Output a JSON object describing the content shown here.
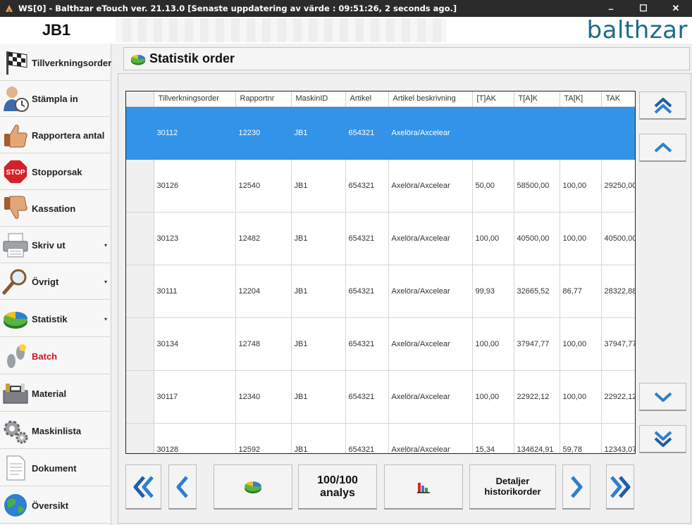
{
  "window": {
    "title": "WS[0] - Balthzar eTouch ver. 21.13.0  [Senaste uppdatering av värde : 09:51:26, 2 seconds ago.]",
    "minimize": "–",
    "maximize": "☐",
    "close": "✕"
  },
  "header": {
    "machine": "JB1",
    "brand": "balthzar"
  },
  "sidebar": {
    "items": [
      {
        "label": "Tillverkningsorder",
        "icon": "checkered-flag-icon",
        "arrow": ""
      },
      {
        "label": "Stämpla in",
        "icon": "user-clock-icon",
        "arrow": ""
      },
      {
        "label": "Rapportera antal",
        "icon": "thumbs-up-icon",
        "arrow": ""
      },
      {
        "label": "Stopporsak",
        "icon": "stop-sign-icon",
        "arrow": ""
      },
      {
        "label": "Kassation",
        "icon": "thumbs-down-icon",
        "arrow": ""
      },
      {
        "label": "Skriv ut",
        "icon": "printer-icon",
        "arrow": "▾"
      },
      {
        "label": "Övrigt",
        "icon": "magnifier-icon",
        "arrow": "▾"
      },
      {
        "label": "Statistik",
        "icon": "pie-chart-icon",
        "arrow": "▾"
      },
      {
        "label": "Batch",
        "icon": "footprints-icon",
        "arrow": ""
      },
      {
        "label": "Material",
        "icon": "toolbox-icon",
        "arrow": ""
      },
      {
        "label": "Maskinlista",
        "icon": "gears-icon",
        "arrow": ""
      },
      {
        "label": "Dokument",
        "icon": "document-icon",
        "arrow": ""
      },
      {
        "label": "Översikt",
        "icon": "globe-icon",
        "arrow": ""
      }
    ]
  },
  "page": {
    "title": "Statistik order"
  },
  "grid": {
    "columns": [
      "Tillverkningsorder",
      "Rapportnr",
      "MaskinID",
      "Artikel",
      "Artikel beskrivning",
      "[T]AK",
      "T[A]K",
      "TA[K]",
      "TAK"
    ],
    "rows": [
      [
        "30112",
        "12230",
        "JB1",
        "654321",
        "Axelöra/Axcelear",
        "",
        "",
        "",
        ""
      ],
      [
        "30126",
        "12540",
        "JB1",
        "654321",
        "Axelöra/Axcelear",
        "50,00",
        "58500,00",
        "100,00",
        "29250,00"
      ],
      [
        "30123",
        "12482",
        "JB1",
        "654321",
        "Axelöra/Axcelear",
        "100,00",
        "40500,00",
        "100,00",
        "40500,00"
      ],
      [
        "30111",
        "12204",
        "JB1",
        "654321",
        "Axelöra/Axcelear",
        "99,93",
        "32665,52",
        "86,77",
        "28322,88"
      ],
      [
        "30134",
        "12748",
        "JB1",
        "654321",
        "Axelöra/Axcelear",
        "100,00",
        "37947,77",
        "100,00",
        "37947,77"
      ],
      [
        "30117",
        "12340",
        "JB1",
        "654321",
        "Axelöra/Axcelear",
        "100,00",
        "22922,12",
        "100,00",
        "22922,12"
      ],
      [
        "30128",
        "12592",
        "JB1",
        "654321",
        "Axelöra/Axcelear",
        "15,34",
        "134624,91",
        "59,78",
        "12343,07"
      ]
    ],
    "selected_row": 0
  },
  "toolbar": {
    "analys_label_1": "100/100",
    "analys_label_2": "analys",
    "detaljer_label_1": "Detaljer",
    "detaljer_label_2": "historikorder"
  },
  "colors": {
    "selection": "#3393e8",
    "brand": "#1b6a8e",
    "active_nav": "#d0161c",
    "arrow_blue": "#2f7fd0"
  }
}
